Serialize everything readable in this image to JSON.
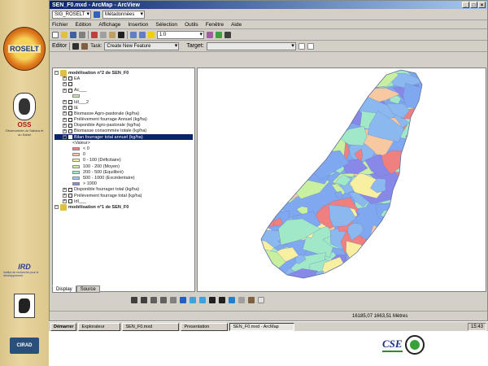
{
  "window": {
    "title": "SEN_F0.mxd - ArcMap - ArcView",
    "controls": [
      "_",
      "□",
      "×"
    ]
  },
  "toolbar1": {
    "combo_value": "SIG_ROSELT",
    "combo2_value": "Métadonnées"
  },
  "menu": [
    "Fichier",
    "Edition",
    "Affichage",
    "Insertion",
    "Sélection",
    "Outils",
    "Fenêtre",
    "Aide"
  ],
  "toolbar2": {
    "scale_value": "1:0"
  },
  "toolbar3": {
    "editor_label": "Editor",
    "task_value": "Create New Feature",
    "target_label": "Target:"
  },
  "toc": {
    "rows": [
      {
        "label": "modélisation n°2 de SEN_F0",
        "type": "dataframe"
      },
      {
        "label": "EA",
        "type": "layer",
        "checked": false
      },
      {
        "label": "",
        "type": "layer",
        "checked": false
      },
      {
        "label": "Ac___",
        "type": "layer",
        "checked": false
      },
      {
        "label": "",
        "type": "legend",
        "color": "#c8e8b0"
      },
      {
        "label": "Idl___2",
        "type": "layer",
        "checked": false
      },
      {
        "label": "IE",
        "type": "layer",
        "checked": false
      },
      {
        "label": "Biomasse Agro-pastorale (kg/ha)",
        "type": "layer",
        "checked": false
      },
      {
        "label": "Prélèvement fourrage Annuel (kg/ha)",
        "type": "layer",
        "checked": false
      },
      {
        "label": "Disponible Agro-pastorale (kg/ha)",
        "type": "layer",
        "checked": false
      },
      {
        "label": "Biomasse consommée totale (kg/ha)",
        "type": "layer",
        "checked": false
      },
      {
        "label": "Bilan fourrager total annuel (kg/ha)",
        "type": "layer",
        "checked": true,
        "selected": true
      },
      {
        "label": "<Valeur>",
        "type": "header"
      },
      {
        "label": "< 0",
        "type": "legend",
        "color": "#f08080"
      },
      {
        "label": "0",
        "type": "legend",
        "color": "#f8c8a0"
      },
      {
        "label": "0 - 100    (Déficitaire)",
        "type": "legend",
        "color": "#f8f0a0"
      },
      {
        "label": "100 - 200    (Moyen)",
        "type": "legend",
        "color": "#c8f0a0"
      },
      {
        "label": "200 - 500    (Equilibré)",
        "type": "legend",
        "color": "#a0e8c8"
      },
      {
        "label": "500 - 1000    (Excédentaire)",
        "type": "legend",
        "color": "#a0c8f8"
      },
      {
        "label": "> 1000",
        "type": "legend",
        "color": "#8888e8"
      },
      {
        "label": "Disponible fourrager total (kg/ha)",
        "type": "layer",
        "checked": false
      },
      {
        "label": "Prélèvement fourrage total (kg/ha)",
        "type": "layer",
        "checked": false
      },
      {
        "label": "Idl___",
        "type": "layer",
        "checked": false
      },
      {
        "label": "modélisation n°1 de SEN_F0",
        "type": "dataframe"
      }
    ],
    "tabs": [
      "Display",
      "Source"
    ]
  },
  "status": {
    "coords": "16185,07  1663,51 Mètres"
  },
  "taskbar": {
    "start": "Démarrer",
    "buttons": [
      "Explorateur",
      "SEN_F0.mxd",
      "Presentation",
      "SEN_F0.mxd - ArcMap"
    ],
    "tray_time": "15:43"
  },
  "logos": {
    "roselt": "ROSELT",
    "oss": "OSS",
    "oss_sub": "Observatoire du Sahara et du Sahel",
    "ird": "IRD",
    "ird_sub": "Institut de recherche pour le développement",
    "cirad": "CIRAD",
    "cse": "CSE"
  },
  "colors": {
    "c_neg": "#f08080",
    "c_zero": "#f8c8a0",
    "c_def": "#f8f0a0",
    "c_moy": "#c8f0a0",
    "c_eq": "#a0e8c8",
    "c_exc": "#8cb8f0",
    "c_high": "#8888e8",
    "c_blue": "#80a8f0"
  }
}
